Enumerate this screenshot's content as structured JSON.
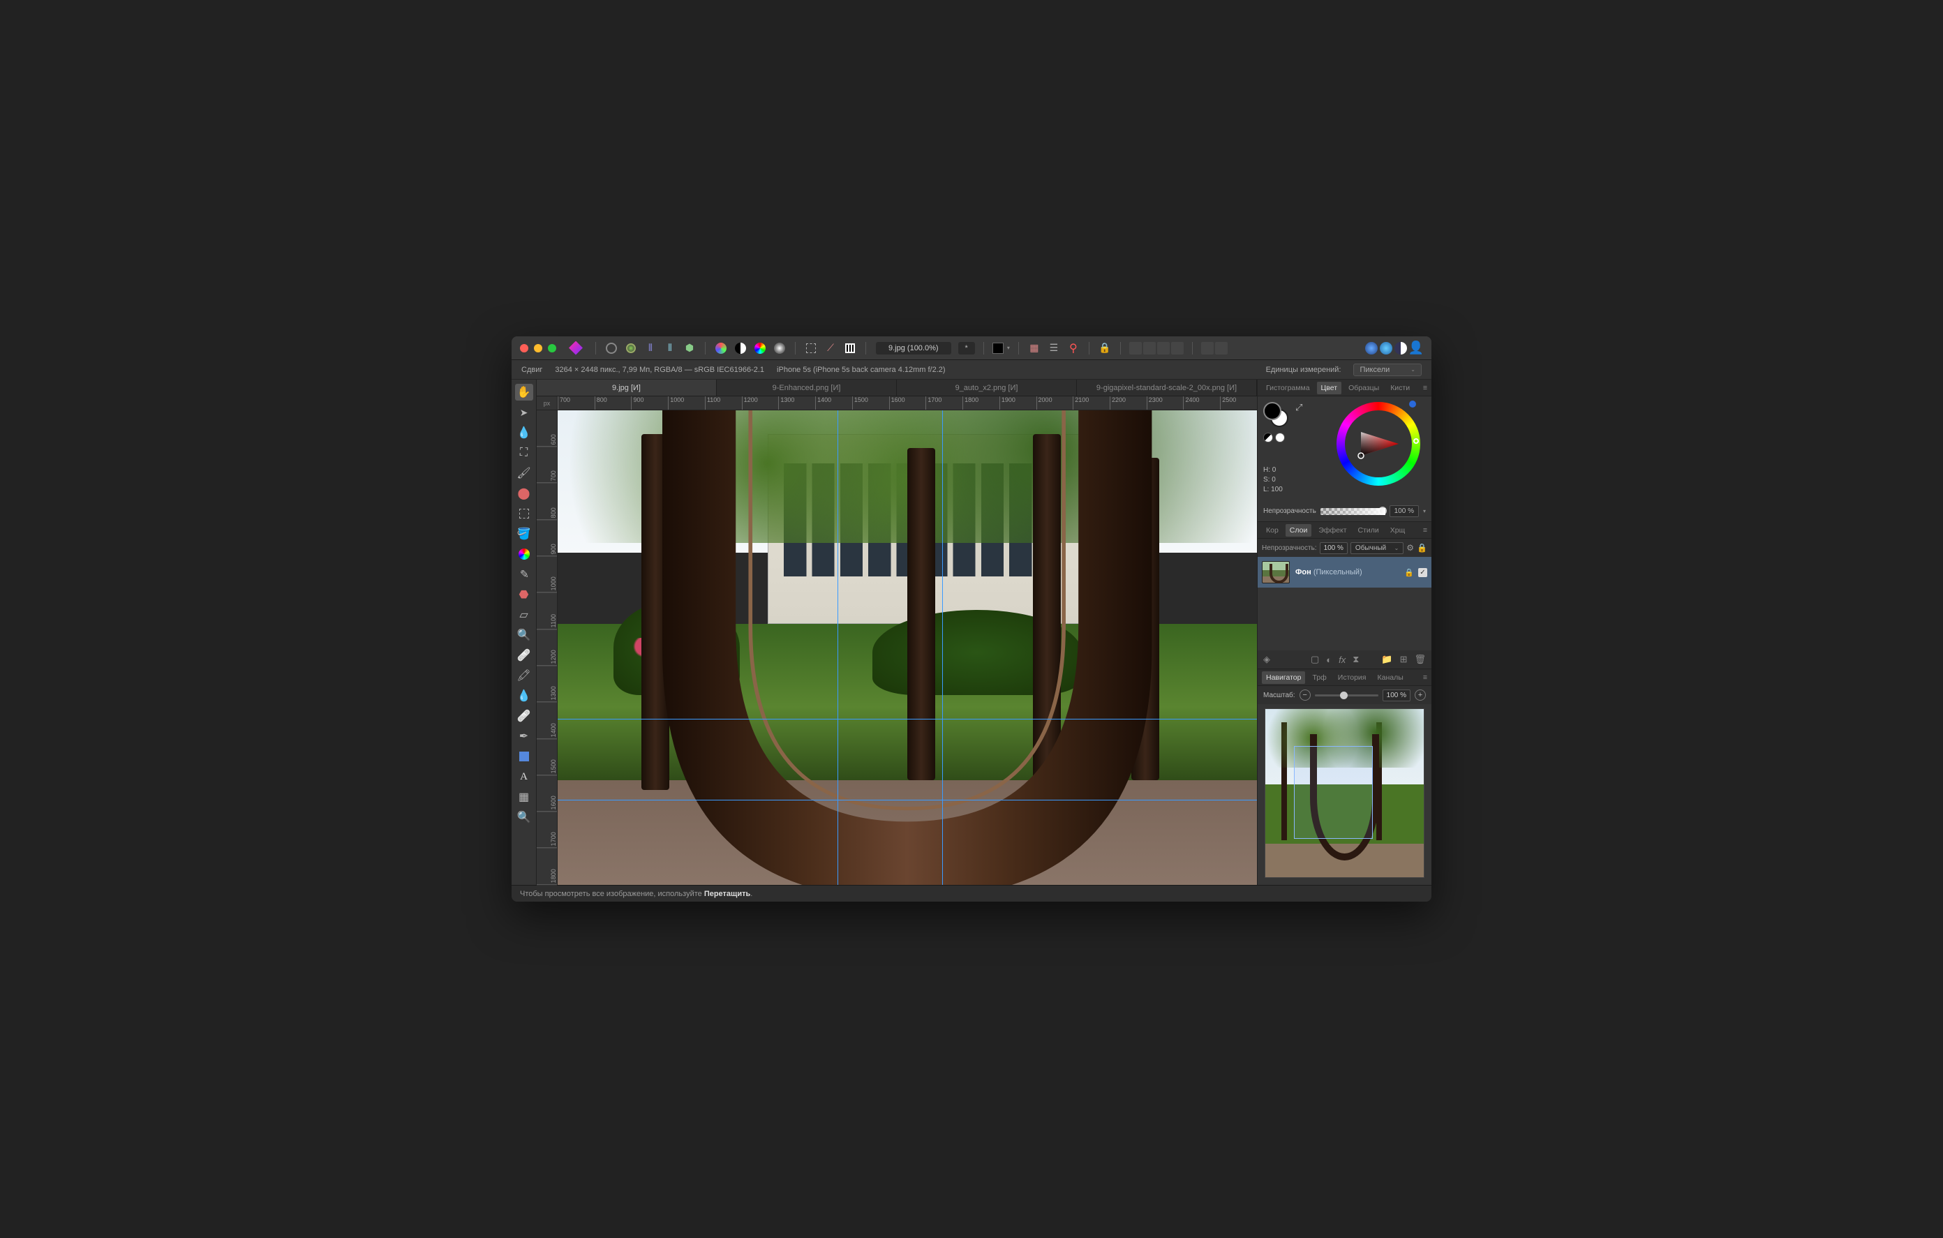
{
  "titlebar": {
    "filename": "9.jpg (100.0%)",
    "modified": "*"
  },
  "infobar": {
    "tool_label": "Сдвиг",
    "dims": "3264 × 2448 пикс., 7,99 Мп, RGBA/8 — sRGB IEC61966-2.1",
    "camera": "iPhone 5s (iPhone 5s back camera 4.12mm f/2.2)",
    "units_label": "Единицы измерений:",
    "units_value": "Пиксели"
  },
  "doctabs": [
    {
      "label": "9.jpg [И]",
      "active": true
    },
    {
      "label": "9-Enhanced.png [И]",
      "active": false
    },
    {
      "label": "9_auto_x2.png [И]",
      "active": false
    },
    {
      "label": "9-gigapixel-standard-scale-2_00x.png [И]",
      "active": false
    }
  ],
  "ruler": {
    "unit": "px",
    "h": [
      "700",
      "800",
      "900",
      "1000",
      "1100",
      "1200",
      "1300",
      "1400",
      "1500",
      "1600",
      "1700",
      "1800",
      "1900",
      "2000",
      "2100",
      "2200",
      "2300",
      "2400",
      "2500"
    ],
    "v": [
      "600",
      "700",
      "800",
      "900",
      "1000",
      "1100",
      "1200",
      "1300",
      "1400",
      "1500",
      "1600",
      "1700",
      "1800"
    ]
  },
  "color_panel": {
    "tabs": [
      "Гистограмма",
      "Цвет",
      "Образцы",
      "Кисти"
    ],
    "active_tab": "Цвет",
    "h": "H: 0",
    "s": "S: 0",
    "l": "L: 100",
    "opacity_label": "Непрозрачность",
    "opacity_value": "100 %"
  },
  "layers_panel": {
    "tabs": [
      "Кор",
      "Слои",
      "Эффект",
      "Стили",
      "Хрщ"
    ],
    "active_tab": "Слои",
    "opacity_label": "Непрозрачность:",
    "opacity_value": "100 %",
    "blend_mode": "Обычный",
    "layer_name": "Фон",
    "layer_type": "(Пиксельный)"
  },
  "navigator_panel": {
    "tabs": [
      "Навигатор",
      "Трф",
      "История",
      "Каналы"
    ],
    "active_tab": "Навигатор",
    "zoom_label": "Масштаб:",
    "zoom_value": "100 %"
  },
  "statusbar": {
    "hint_prefix": "Чтобы просмотреть все изображение, используйте ",
    "hint_action": "Перетащить"
  }
}
